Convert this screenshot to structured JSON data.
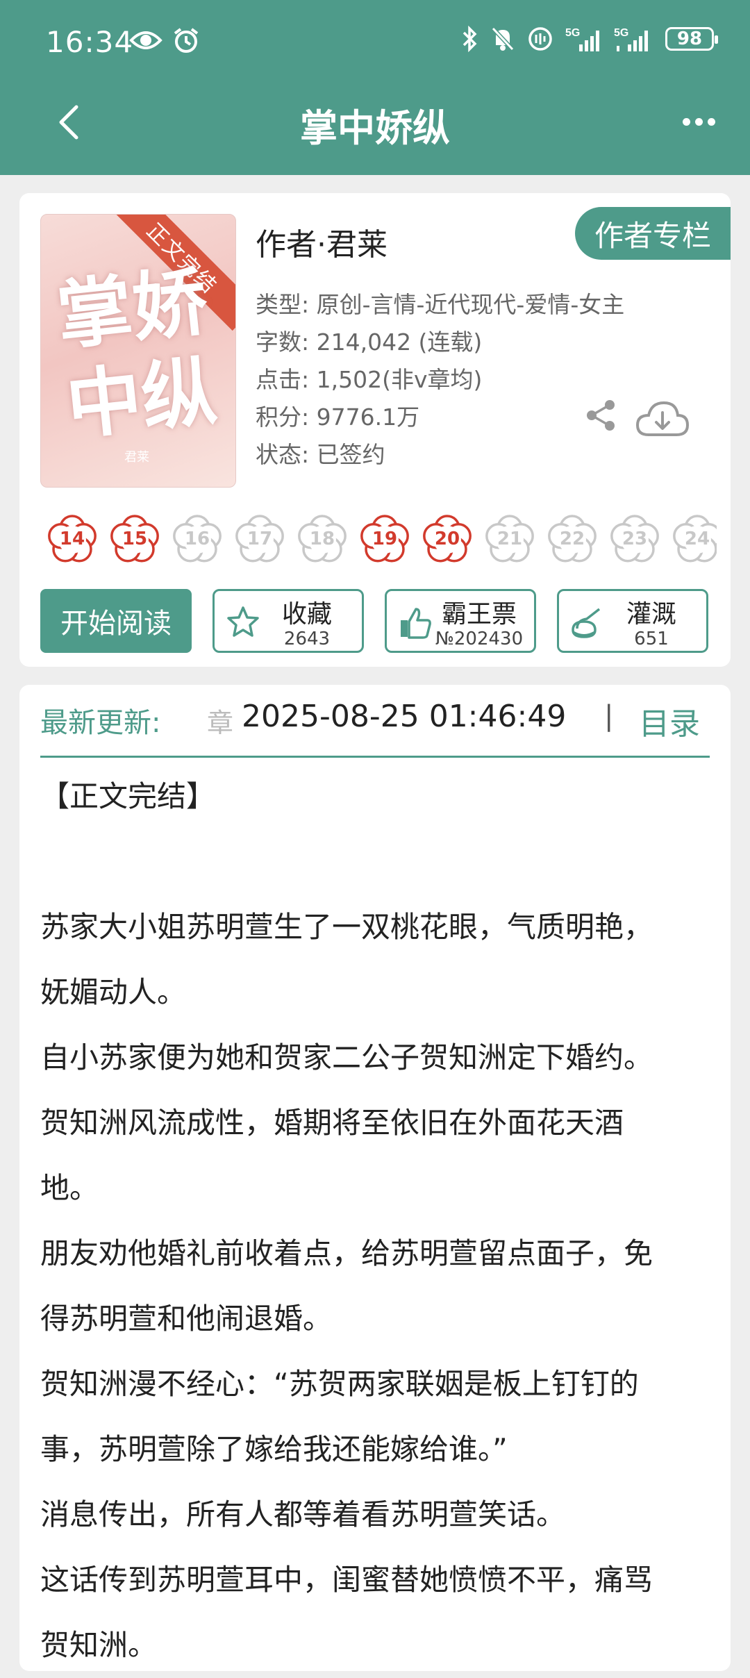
{
  "status_bar": {
    "time": "16:34",
    "net_badge": "5G",
    "battery": "98"
  },
  "header": {
    "title": "掌中娇纵"
  },
  "book": {
    "cover_title_text": "掌娇中纵",
    "cover_ribbon": "正文完结",
    "cover_author_small": "君莱",
    "author_column_label": "作者专栏",
    "author": "作者·君莱",
    "meta": [
      "类型: 原创-言情-近代现代-爱情-女主",
      "字数: 214,042 (连载)",
      "点击: 1,502(非v章均)",
      "积分: 9776.1万",
      "状态: 已签约"
    ],
    "rank_flowers": [
      {
        "n": "14",
        "active": true
      },
      {
        "n": "15",
        "active": true
      },
      {
        "n": "16",
        "active": false
      },
      {
        "n": "17",
        "active": false
      },
      {
        "n": "18",
        "active": false
      },
      {
        "n": "19",
        "active": true
      },
      {
        "n": "20",
        "active": true
      },
      {
        "n": "21",
        "active": false
      },
      {
        "n": "22",
        "active": false
      },
      {
        "n": "23",
        "active": false
      },
      {
        "n": "24",
        "active": false
      }
    ],
    "start_read": "开始阅读",
    "collect": {
      "label": "收藏",
      "count": "2643"
    },
    "ticket": {
      "label": "霸王票",
      "count": "№202430"
    },
    "water": {
      "label": "灌溉",
      "count": "651"
    }
  },
  "update": {
    "label": "最新更新:",
    "ghost": "章",
    "time": "2025-08-25 01:46:49",
    "sep": "|",
    "toc": "目录"
  },
  "synopsis": [
    "【正文完结】",
    "",
    "苏家大小姐苏明萱生了一双桃花眼，气质明艳，",
    "妩媚动人。",
    "自小苏家便为她和贺家二公子贺知洲定下婚约。",
    "贺知洲风流成性，婚期将至依旧在外面花天酒",
    "地。",
    "朋友劝他婚礼前收着点，给苏明萱留点面子，免",
    "得苏明萱和他闹退婚。",
    "贺知洲漫不经心：“苏贺两家联姻是板上钉钉的",
    "事，苏明萱除了嫁给我还能嫁给谁。”",
    "消息传出，所有人都等着看苏明萱笑话。",
    "这话传到苏明萱耳中，闺蜜替她愤愤不平，痛骂",
    "贺知洲。"
  ],
  "colors": {
    "primary": "#4e9b8a",
    "flower_active": "#d23a2c",
    "flower_inactive": "#c8c8c8"
  }
}
